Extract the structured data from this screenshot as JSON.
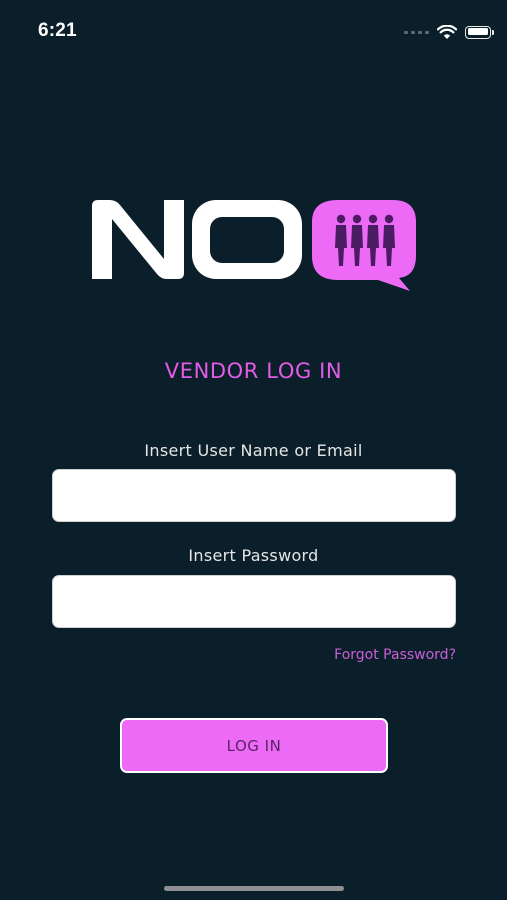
{
  "status_bar": {
    "time": "6:21",
    "icons": [
      "cellular-signal-icon",
      "wifi-icon",
      "battery-icon"
    ]
  },
  "logo": {
    "text": "NOQ",
    "icon": "people-queue-icon",
    "colors": {
      "letters": "#ffffff",
      "bubble": "#ec6af5",
      "figures": "#4a1d63"
    }
  },
  "login": {
    "title": "VENDOR LOG IN",
    "username_label": "Insert User Name or Email",
    "username_value": "",
    "password_label": "Insert Password",
    "password_value": "",
    "forgot_password": "Forgot Password?",
    "submit_label": "LOG IN"
  },
  "theme": {
    "background": "#0b1f2a",
    "accent": "#ec6af5",
    "accent_text": "#e25ce6"
  }
}
